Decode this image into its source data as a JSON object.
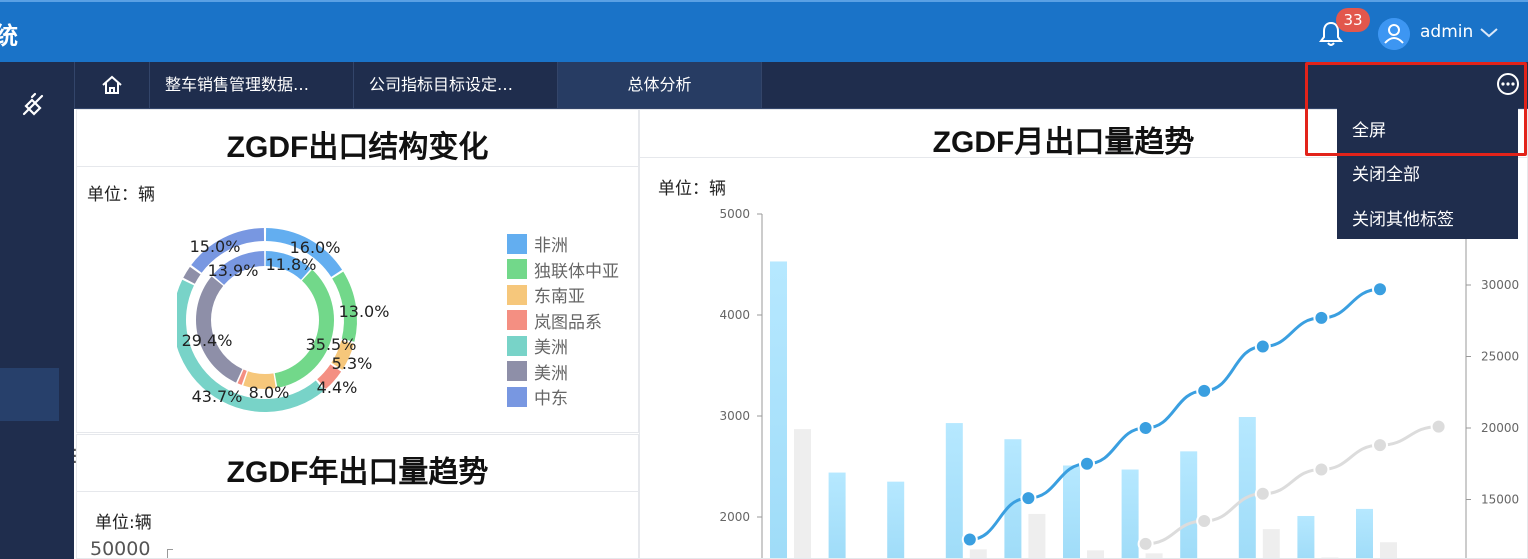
{
  "header": {
    "title_fragment": "统",
    "notification_count": "33",
    "username": "admin"
  },
  "tabs": [
    {
      "label": "整车销售管理数据…"
    },
    {
      "label": "公司指标目标设定…"
    },
    {
      "label": "总体分析"
    }
  ],
  "dropdown": {
    "items": [
      {
        "label": "全屏"
      },
      {
        "label": "关闭全部"
      },
      {
        "label": "关闭其他标签"
      }
    ]
  },
  "panels": {
    "structure": {
      "title": "ZGDF出口结构变化",
      "unit": "单位：辆"
    },
    "yearly": {
      "title": "ZGDF年出口量趋势",
      "unit": "单位:辆",
      "ytick_top": "50000"
    },
    "monthly": {
      "title": "ZGDF月出口量趋势",
      "unit": "单位：辆"
    }
  },
  "colors": {
    "accent_header": "#1a73c8",
    "sidebar_bg": "#1f2d4d",
    "badge": "#e2574c",
    "highlight": "#e2231a"
  },
  "chart_data": [
    {
      "type": "pie",
      "title": "ZGDF出口结构变化",
      "legend": [
        "非洲",
        "独联体中亚",
        "东南亚",
        "岚图品系",
        "美洲",
        "美洲",
        "中东"
      ],
      "legend_colors": [
        "#63aef0",
        "#72d88a",
        "#f6c77b",
        "#f48f82",
        "#78d3c8",
        "#8e8fa8",
        "#7897e1"
      ],
      "series": [
        {
          "ring": "outer",
          "labels": [
            "非洲",
            "独联体中亚",
            "东南亚",
            "岚图品系",
            "美洲",
            "美洲",
            "中东"
          ],
          "values": [
            16.0,
            13.0,
            5.3,
            4.4,
            43.7,
            2.6,
            15.0
          ],
          "value_labels": [
            "16.0%",
            "13.0%",
            "5.3%",
            "4.4%",
            "43.7%",
            "",
            "15.0%"
          ]
        },
        {
          "ring": "inner",
          "labels": [
            "非洲",
            "独联体中亚",
            "东南亚",
            "岚图品系",
            "美洲",
            "美洲",
            "中东"
          ],
          "values": [
            11.8,
            35.5,
            8.0,
            1.4,
            0,
            29.4,
            13.9
          ],
          "value_labels": [
            "11.8%",
            "35.5%",
            "8.0%",
            "",
            "",
            "29.4%",
            "13.9%"
          ]
        }
      ],
      "legend_position": "right"
    },
    {
      "type": "bar",
      "title": "ZGDF月出口量趋势",
      "ylabel": "单位：辆",
      "y_left_ticks": [
        "5000",
        "4000",
        "3000",
        "2000"
      ],
      "y_right_ticks": [
        "30000",
        "25000",
        "20000",
        "15000"
      ],
      "ylim_left": [
        0,
        5000
      ],
      "bars_primary": [
        4530,
        2440,
        2350,
        2930,
        2770,
        2510,
        2470,
        2650,
        2990,
        2010,
        2080
      ],
      "bars_secondary": [
        2870,
        0,
        0,
        1680,
        2030,
        1670,
        1640,
        1580,
        1880,
        1600,
        1750
      ],
      "line_primary_right": [
        null,
        null,
        null,
        12200,
        15100,
        17500,
        20000,
        22600,
        25700,
        27700,
        29700
      ],
      "line_secondary_right": [
        null,
        null,
        null,
        null,
        null,
        null,
        11900,
        13500,
        15400,
        17100,
        18800,
        20100
      ],
      "grid": false
    },
    {
      "type": "line",
      "title": "ZGDF年出口量趋势",
      "ylabel": "单位:辆",
      "y_ticks": [
        "50000"
      ]
    }
  ]
}
